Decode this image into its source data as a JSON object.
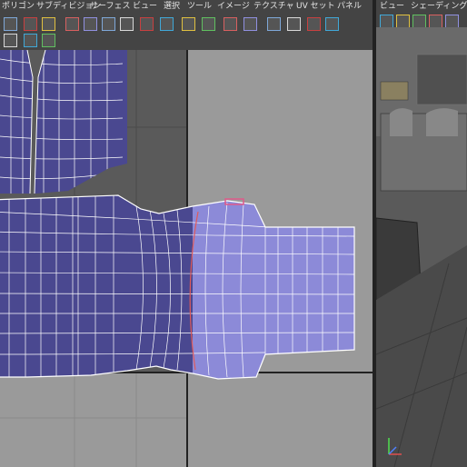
{
  "uv_editor": {
    "menu": [
      "ポリゴン",
      "サブディビジョン",
      "サーフェス",
      "ビュー",
      "選択",
      "ツール",
      "イメージ",
      "テクスチャ",
      "UV セット",
      "パネル"
    ]
  },
  "perspective": {
    "menu": [
      "ビュー",
      "シェーディング"
    ]
  },
  "colors": {
    "uv_shell_fill": "#4a4890",
    "uv_shell_selected": "#8c8ad8",
    "uv_grid_background": "#9a9a9a",
    "uv_dark_region": "#5a5a5a",
    "uv_wire": "#ffffff",
    "selected_edge": "#e05a5a",
    "menu_text": "#e6e6e6"
  },
  "icons": {
    "uv_toolbar": [
      "grid-snap-icon",
      "select-uv-icon",
      "move-uv-icon",
      "rotate-uv-icon",
      "scale-uv-icon",
      "flip-u-icon",
      "flip-v-icon",
      "rotate-cw-icon",
      "rotate-ccw-icon",
      "cut-uv-icon",
      "sew-uv-icon",
      "layout-uv-icon",
      "align-uv-icon",
      "unfold-icon",
      "relax-icon",
      "snapshot-icon",
      "texture-display-icon",
      "checker-icon",
      "isolate-icon",
      "shaded-uv-icon",
      "color-display-icon",
      "dim-image-icon"
    ],
    "persp_toolbar": [
      "camera-icon",
      "wireframe-icon",
      "smooth-shade-icon",
      "texture-icon",
      "light-icon"
    ]
  }
}
